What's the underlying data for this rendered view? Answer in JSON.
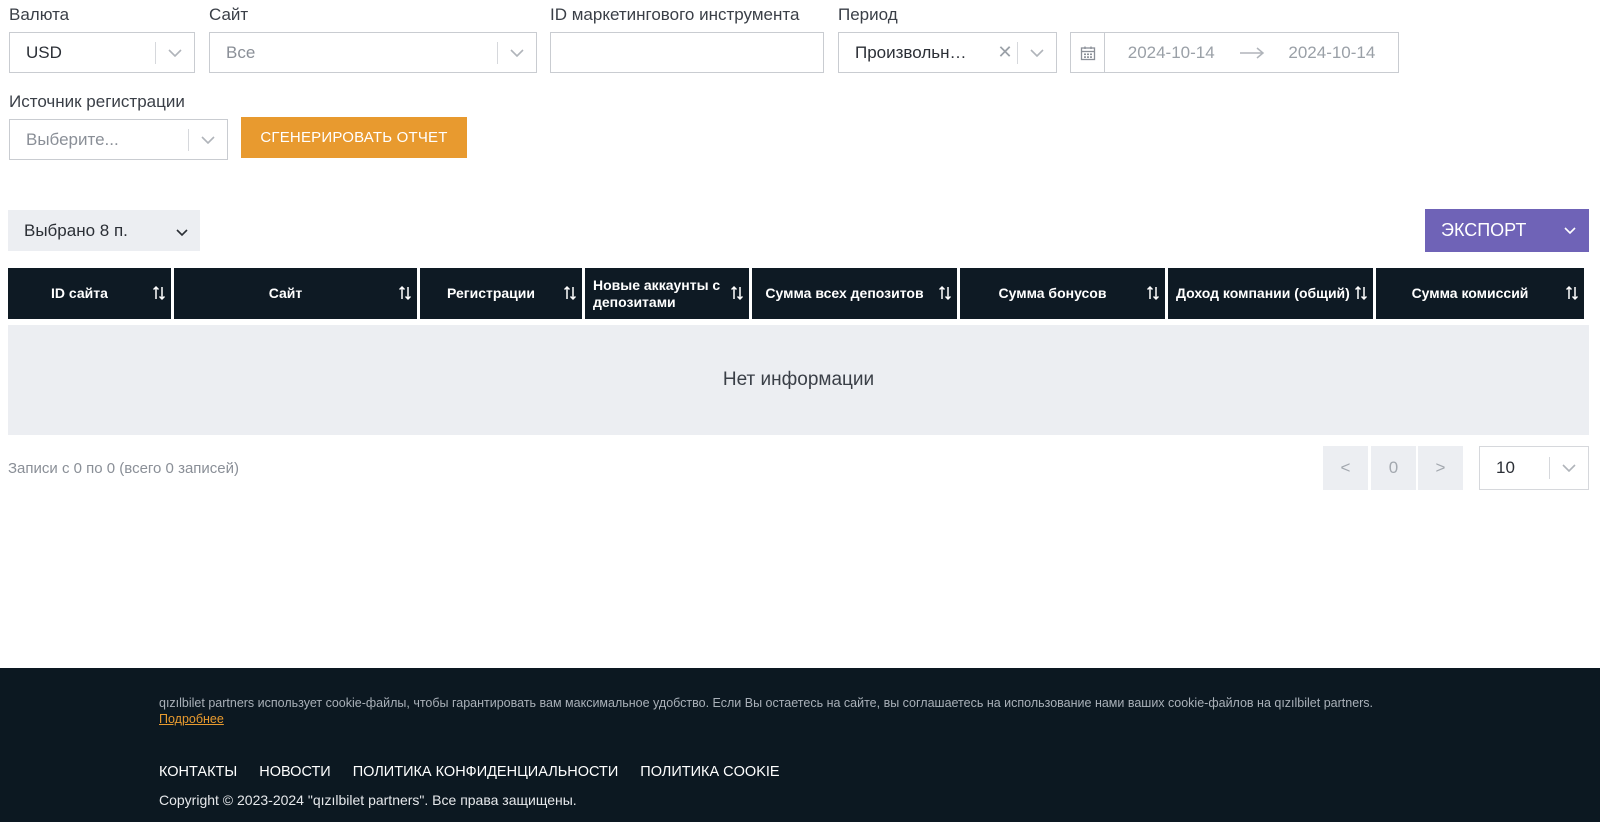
{
  "filters": {
    "currency": {
      "label": "Валюта",
      "value": "USD"
    },
    "site": {
      "label": "Сайт",
      "value": "Все"
    },
    "marketing_tool_id": {
      "label": "ID маркетингового инструмента",
      "value": ""
    },
    "period": {
      "label": "Период",
      "value": "Произвольн…"
    },
    "date_range": {
      "from": "2024-10-14",
      "to": "2024-10-14"
    },
    "registration_source": {
      "label": "Источник регистрации",
      "placeholder": "Выберите..."
    },
    "generate_button": "СГЕНЕРИРОВАТЬ ОТЧЕТ"
  },
  "toolbar": {
    "selected_columns": "Выбрано 8 п.",
    "export_label": "ЭКСПОРТ"
  },
  "table": {
    "columns": [
      "ID сайта",
      "Сайт",
      "Регистрации",
      "Новые аккаунты с депозитами",
      "Сумма всех депозитов",
      "Сумма бонусов",
      "Доход компании (общий)",
      "Сумма комиссий"
    ],
    "empty_text": "Нет информации"
  },
  "pagination": {
    "records_info": "Записи с 0 по 0 (всего 0 записей)",
    "prev": "<",
    "page": "0",
    "next": ">",
    "page_size": "10"
  },
  "footer": {
    "cookie_text": "qızılbilet partners использует cookie-файлы, чтобы гарантировать вам максимальное удобство. Если Вы остаетесь на сайте, вы соглашаетесь на использование нами ваших cookie-файлов на qızılbilet partners.",
    "cookie_more": "Подробнее",
    "links": [
      "КОНТАКТЫ",
      "НОВОСТИ",
      "ПОЛИТИКА КОНФИДЕНЦИАЛЬНОСТИ",
      "ПОЛИТИКА COOKIE"
    ],
    "copyright": "Copyright © 2023-2024 \"qızılbilet partners\". Все права защищены."
  },
  "colors": {
    "accent_orange": "#e89a2f",
    "export_purple": "#6f63b7",
    "table_header": "#0e1a24",
    "footer_bg": "#0c1821"
  }
}
